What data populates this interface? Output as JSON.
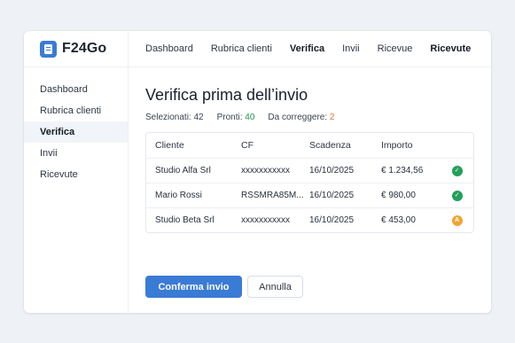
{
  "app": {
    "name": "F24Go"
  },
  "topnav": [
    {
      "label": "Dashboard",
      "active": false
    },
    {
      "label": "Rubrica clienti",
      "active": false
    },
    {
      "label": "Verifica",
      "active": true
    },
    {
      "label": "Invii",
      "active": false
    },
    {
      "label": "Ricevue",
      "active": false
    },
    {
      "label": "Ricevute",
      "active": true
    }
  ],
  "sidebar": [
    {
      "label": "Dashboard",
      "active": false
    },
    {
      "label": "Rubrica clienti",
      "active": false
    },
    {
      "label": "Verifica",
      "active": true
    },
    {
      "label": "Invii",
      "active": false
    },
    {
      "label": "Ricevute",
      "active": false
    }
  ],
  "main": {
    "title": "Verifica prima dell’invio",
    "stats": {
      "selected_label": "Selezionati:",
      "selected_value": "42",
      "ready_label": "Pronti:",
      "ready_value": "40",
      "fix_label": "Da correggere:",
      "fix_value": "2"
    },
    "table": {
      "headers": {
        "client": "Cliente",
        "cf": "CF",
        "due": "Scadenza",
        "amount": "Importo"
      },
      "rows": [
        {
          "client": "Studio Alfa Srl",
          "cf": "xxxxxxxxxxx",
          "due": "16/10/2025",
          "amount": "€ 1.234,56",
          "status": "ok",
          "status_glyph": "✓",
          "status_color": "#23a05a"
        },
        {
          "client": "Mario Rossi",
          "cf": "RSSMRA85M...",
          "due": "16/10/2025",
          "amount": "€ 980,00",
          "status": "ok",
          "status_glyph": "✓",
          "status_color": "#23a05a"
        },
        {
          "client": "Studio Beta Srl",
          "cf": "xxxxxxxxxxx",
          "due": "16/10/2025",
          "amount": "€ 453,00",
          "status": "warning",
          "status_glyph": "A",
          "status_color": "#f0a534"
        }
      ]
    },
    "actions": {
      "confirm_label": "Conferma invio",
      "cancel_label": "Annulla"
    }
  },
  "colors": {
    "accent": "#3a7bd5",
    "ok": "#23a05a",
    "warning": "#f0a534",
    "fix": "#e8742b",
    "ready": "#23914f"
  }
}
